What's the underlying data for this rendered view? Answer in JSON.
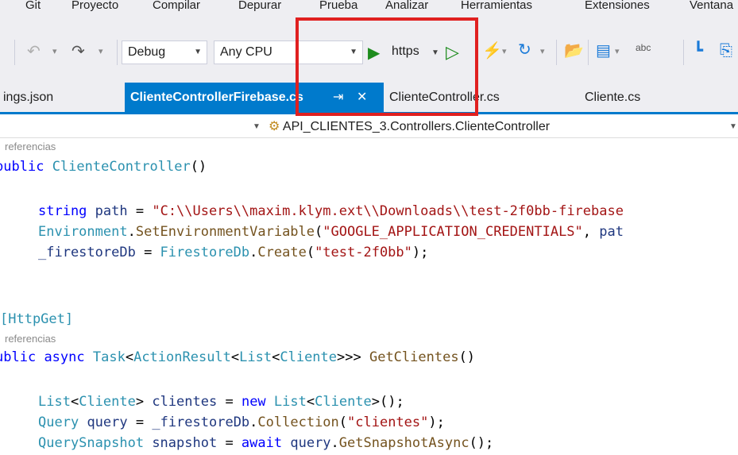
{
  "menu": [
    "Git",
    "Proyecto",
    "Compilar",
    "Depurar",
    "Prueba",
    "Analizar",
    "Herramientas",
    "Extensiones",
    "Ventana"
  ],
  "toolbar": {
    "config": "Debug",
    "platform": "Any CPU",
    "run_profile": "https https"
  },
  "tabs": [
    {
      "label": "ings.json"
    },
    {
      "label": "ClienteControllerFirebase.cs",
      "pin": "⇥",
      "close": "✕"
    },
    {
      "label": "ClienteController.cs"
    },
    {
      "label": "Cliente.cs"
    }
  ],
  "navbar": {
    "member": "API_CLIENTES_3.Controllers.ClienteController"
  },
  "code": {
    "ref1": "referencias",
    "ctor_line": "ublic ClienteController()",
    "line_path": "string path = \"C:\\\\Users\\\\maxim.klym.ext\\\\Downloads\\\\test-2f0bb-firebase",
    "line_env": "Environment.SetEnvironmentVariable(\"GOOGLE_APPLICATION_CREDENTIALS\", pat",
    "line_db": "_firestoreDb = FirestoreDb.Create(\"test-2f0bb\");",
    "attr": "[HttpGet]",
    "ref2": "referencias",
    "method_line": "ublic async Task<ActionResult<List<Cliente>>> GetClientes()",
    "line_list": "List<Cliente> clientes = new List<Cliente>();",
    "line_query": "Query query = _firestoreDb.Collection(\"clientes\");",
    "line_snap": "QuerySnapshot snapshot = await query.GetSnapshotAsync();"
  },
  "colors": {
    "accent": "#007acc",
    "highlight": "#e02020",
    "run_green": "#1e8c1e"
  }
}
